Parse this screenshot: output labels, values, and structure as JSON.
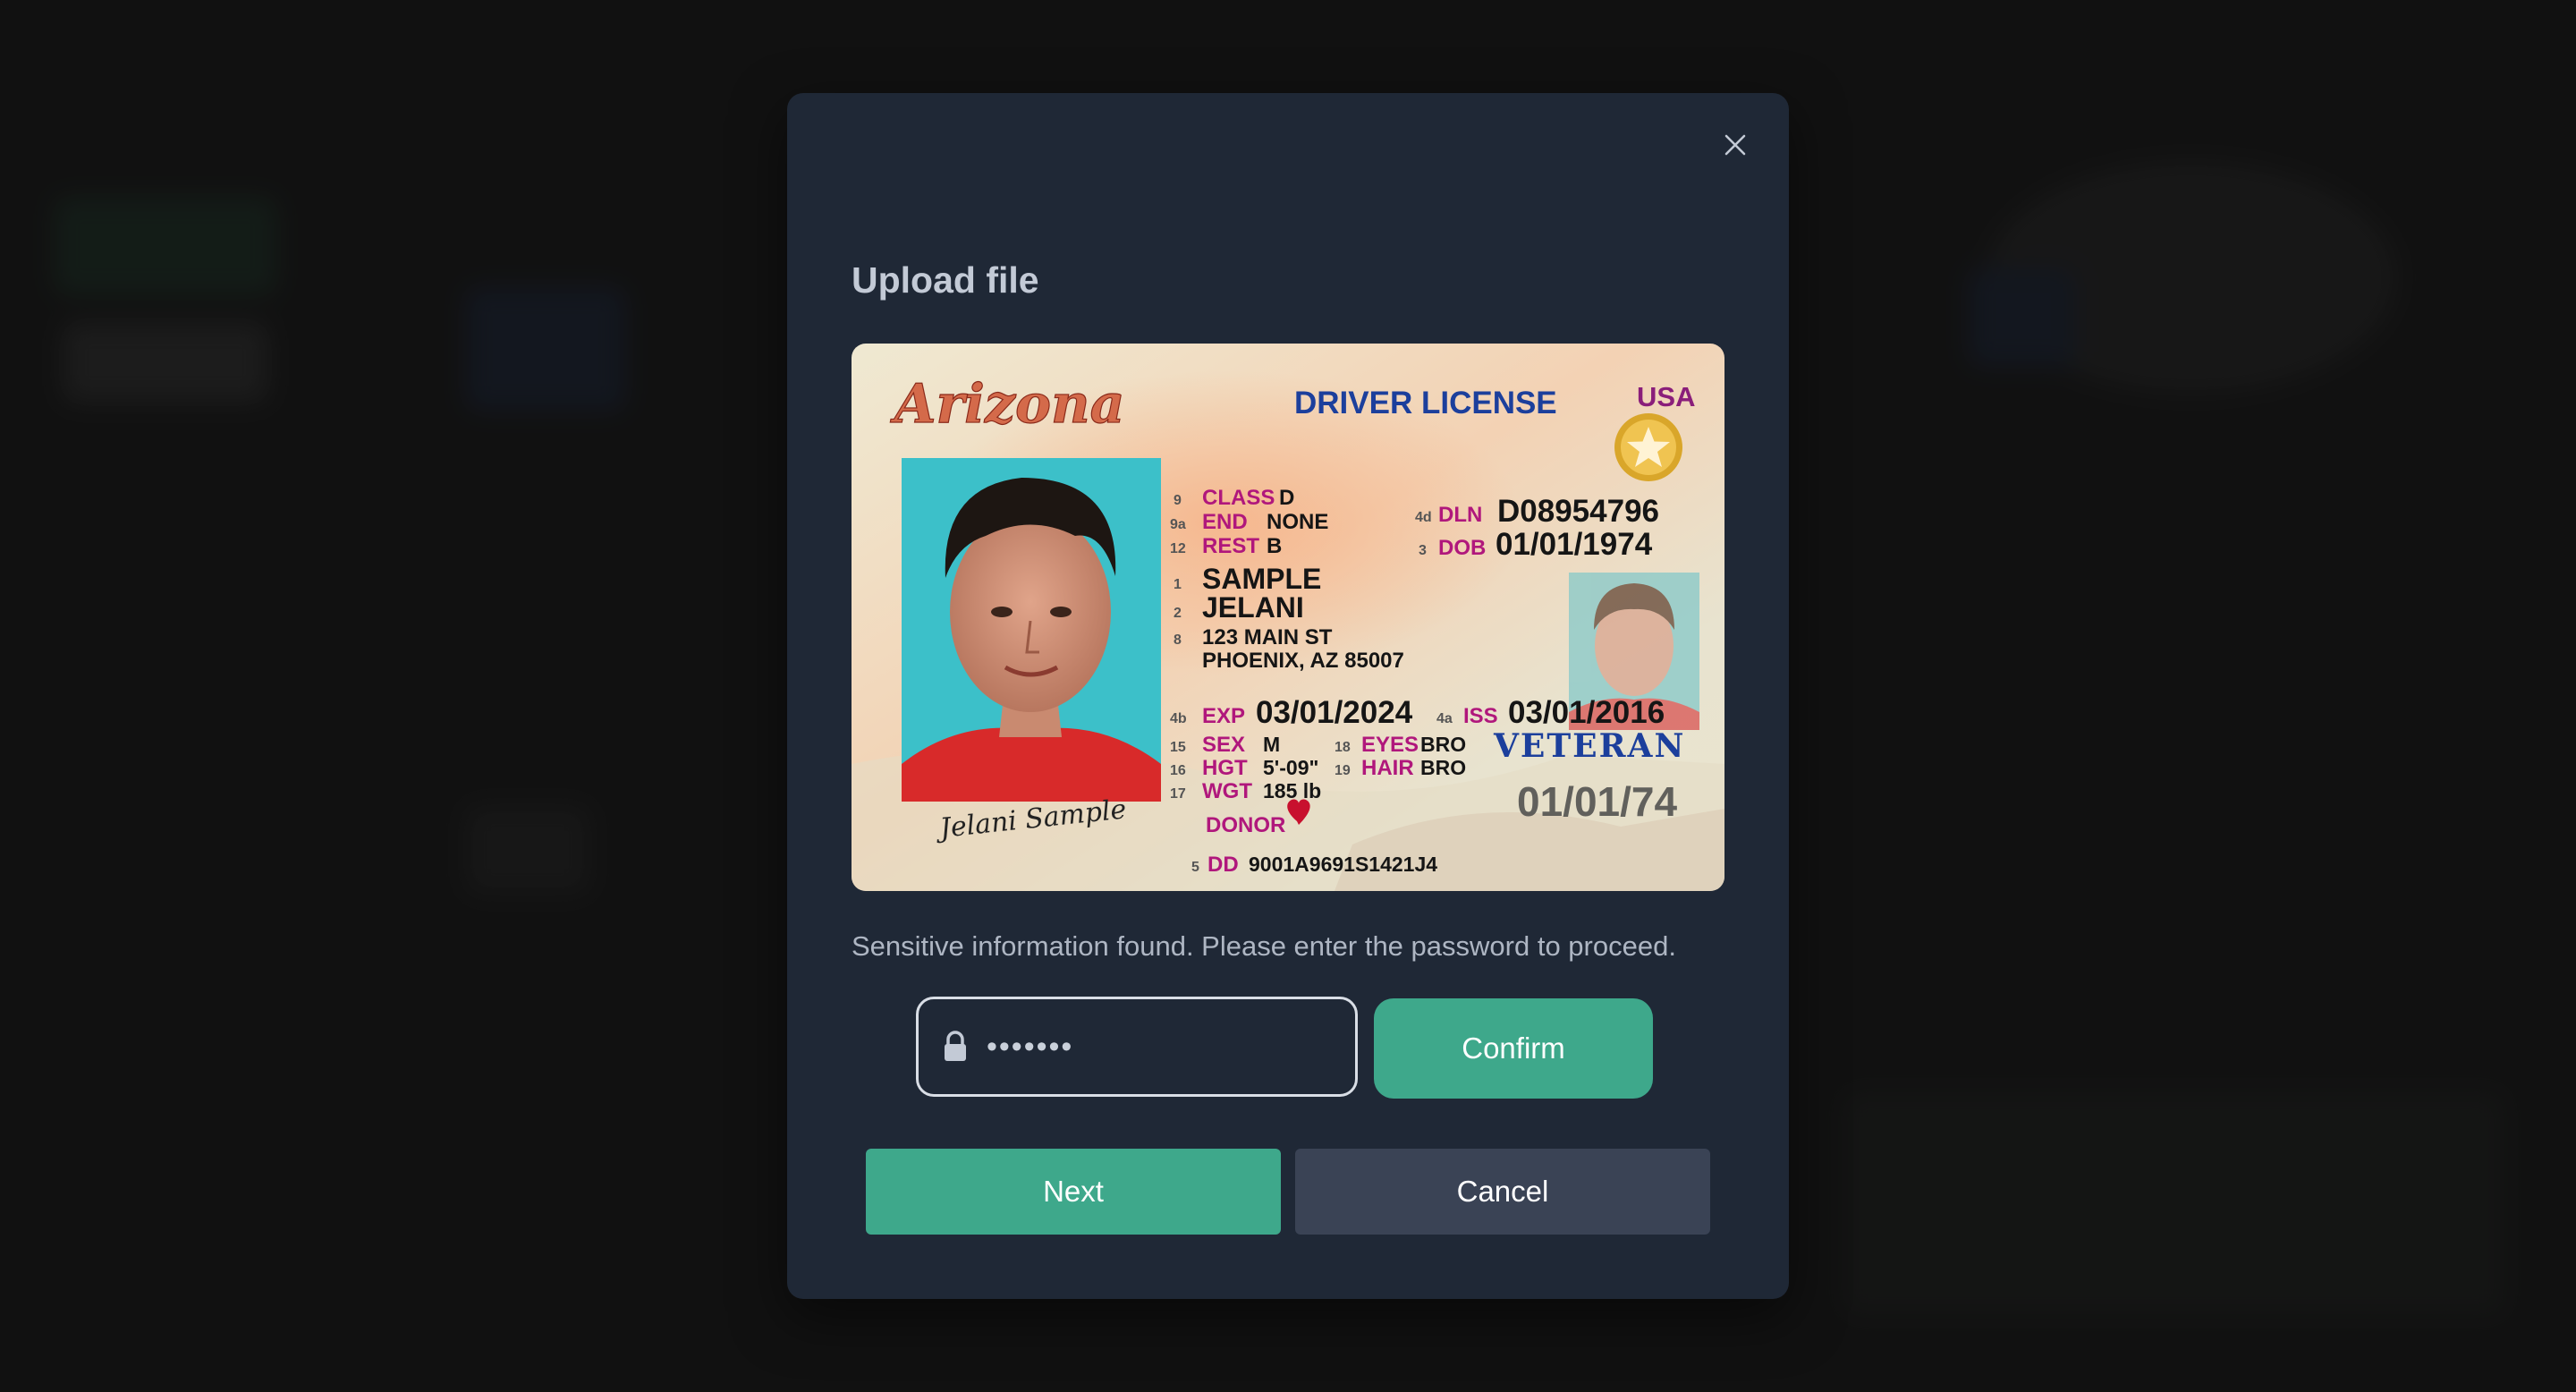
{
  "modal": {
    "title": "Upload file",
    "notice": "Sensitive information found. Please enter the password to proceed.",
    "password": {
      "value": "•••••••",
      "icon": "lock-icon"
    },
    "confirm_label": "Confirm",
    "next_label": "Next",
    "cancel_label": "Cancel",
    "close_icon": "close-icon"
  },
  "license": {
    "state": "Arizona",
    "doc_type": "DRIVER LICENSE",
    "country": "USA",
    "class_num": "9",
    "class_label": "CLASS",
    "class_value": "D",
    "end_num": "9a",
    "end_label": "END",
    "end_value": "NONE",
    "rest_num": "12",
    "rest_label": "REST",
    "rest_value": "B",
    "dln_num": "4d",
    "dln_label": "DLN",
    "dln_value": "D08954796",
    "dob_num": "3",
    "dob_label": "DOB",
    "dob_value": "01/01/1974",
    "last_num": "1",
    "last_name": "SAMPLE",
    "first_num": "2",
    "first_name": "JELANI",
    "addr_num": "8",
    "address1": "123 MAIN ST",
    "address2": "PHOENIX, AZ 85007",
    "exp_num": "4b",
    "exp_label": "EXP",
    "exp_value": "03/01/2024",
    "iss_num": "4a",
    "iss_label": "ISS",
    "iss_value": "03/01/2016",
    "sex_num": "15",
    "sex_label": "SEX",
    "sex_value": "M",
    "hgt_num": "16",
    "hgt_label": "HGT",
    "hgt_value": "5'-09\"",
    "wgt_num": "17",
    "wgt_label": "WGT",
    "wgt_value": "185 lb",
    "eyes_num": "18",
    "eyes_label": "EYES",
    "eyes_value": "BRO",
    "hair_num": "19",
    "hair_label": "HAIR",
    "hair_value": "BRO",
    "veteran": "VETERAN",
    "dob_ghost": "01/01/74",
    "donor": "DONOR",
    "dd_num": "5",
    "dd_label": "DD",
    "dd_value": "9001A9691S1421J4",
    "signature": "Jelani Sample"
  },
  "colors": {
    "accent": "#3ea88b",
    "modal_bg": "#1f2836",
    "cancel_bg": "#3a4355",
    "field_label": "#b0177c",
    "license_title": "#1c3f9c"
  }
}
